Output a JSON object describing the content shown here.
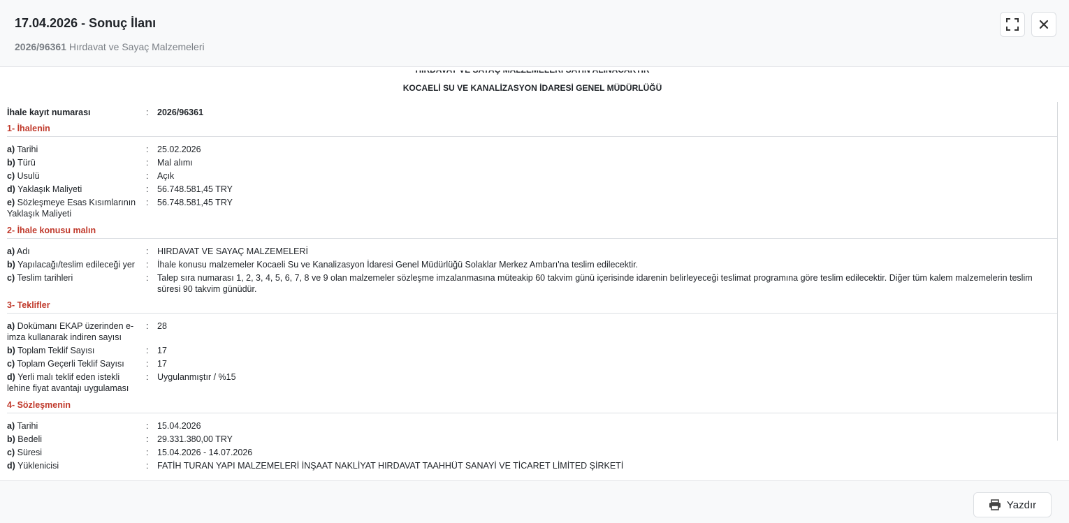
{
  "header": {
    "title": "17.04.2026 - Sonuç İlanı",
    "tender_code": "2026/96361",
    "tender_name": "Hırdavat ve Sayaç Malzemeleri"
  },
  "document": {
    "head_line1": "HIRDAVAT VE SAYAÇ MALZEMELERİ SATIN ALINACAKTIR",
    "head_line2": "KOCAELİ SU VE KANALİZASYON İDARESİ GENEL MÜDÜRLÜĞÜ",
    "registry": {
      "label": "İhale kayıt numarası",
      "value": "2026/96361"
    },
    "sections": [
      {
        "title": "1- İhalenin",
        "rows": [
          {
            "letter": "a)",
            "label": "Tarihi",
            "value": "25.02.2026"
          },
          {
            "letter": "b)",
            "label": "Türü",
            "value": "Mal alımı"
          },
          {
            "letter": "c)",
            "label": "Usulü",
            "value": "Açık"
          },
          {
            "letter": "d)",
            "label": "Yaklaşık Maliyeti",
            "value": "56.748.581,45 TRY"
          },
          {
            "letter": "e)",
            "label": "Sözleşmeye Esas Kısımlarının Yaklaşık Maliyeti",
            "value": "56.748.581,45 TRY"
          }
        ]
      },
      {
        "title": "2- İhale konusu malın",
        "rows": [
          {
            "letter": "a)",
            "label": "Adı",
            "value": "HIRDAVAT VE SAYAÇ MALZEMELERİ"
          },
          {
            "letter": "b)",
            "label": "Yapılacağı/teslim edileceği yer",
            "value": "İhale konusu malzemeler Kocaeli Su ve Kanalizasyon İdaresi Genel Müdürlüğü Solaklar Merkez Ambarı'na teslim edilecektir."
          },
          {
            "letter": "c)",
            "label": "Teslim tarihleri",
            "value": "Talep sıra numarası 1, 2, 3, 4, 5, 6, 7, 8 ve 9 olan malzemeler sözleşme imzalanmasına müteakip 60 takvim günü içerisinde idarenin belirleyeceği teslimat programına göre teslim edilecektir. Diğer tüm kalem malzemelerin teslim süresi 90 takvim günüdür."
          }
        ]
      },
      {
        "title": "3- Teklifler",
        "rows": [
          {
            "letter": "a)",
            "label": "Dokümanı EKAP üzerinden e-imza kullanarak indiren sayısı",
            "value": "28"
          },
          {
            "letter": "b)",
            "label": "Toplam Teklif Sayısı",
            "value": "17"
          },
          {
            "letter": "c)",
            "label": "Toplam Geçerli Teklif Sayısı",
            "value": "17"
          },
          {
            "letter": "d)",
            "label": "Yerli malı teklif eden istekli lehine fiyat avantajı uygulaması",
            "value": "Uygulanmıştır / %15"
          }
        ]
      },
      {
        "title": "4- Sözleşmenin",
        "rows": [
          {
            "letter": "a)",
            "label": "Tarihi",
            "value": "15.04.2026"
          },
          {
            "letter": "b)",
            "label": "Bedeli",
            "value": "29.331.380,00 TRY"
          },
          {
            "letter": "c)",
            "label": "Süresi",
            "value": "15.04.2026 - 14.07.2026"
          },
          {
            "letter": "d)",
            "label": "Yüklenicisi",
            "value": "FATİH TURAN YAPI MALZEMELERİ İNŞAAT NAKLİYAT HIRDAVAT TAAHHÜT SANAYİ VE TİCARET LİMİTED ŞİRKETİ"
          }
        ]
      }
    ]
  },
  "footer": {
    "print_label": "Yazdır"
  },
  "icons": {
    "expand": "expand-icon",
    "close": "close-icon",
    "print": "printer-icon"
  }
}
